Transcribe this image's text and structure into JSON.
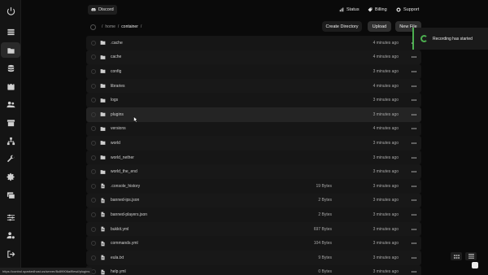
{
  "topbar": {
    "discord_label": "Discord",
    "status_label": "Status",
    "billing_label": "Billing",
    "support_label": "Support"
  },
  "breadcrumb": {
    "separator": "/",
    "home": "home",
    "container": "container"
  },
  "actions": {
    "create_directory": "Create Directory",
    "upload": "Upload",
    "new_file": "New File"
  },
  "toast": {
    "message": "Recording has started"
  },
  "status_url": "https://control.sparkedhost.us/server/8c89906a/files#/plugins",
  "sidebar": {
    "items": [
      "dashboard-icon",
      "files-icon",
      "database-icon",
      "schedule-icon",
      "users-icon",
      "backups-icon",
      "network-icon",
      "wrench-icon",
      "settings-icon",
      "console-icon",
      "sliders-icon",
      "user-settings-icon",
      "logout-icon"
    ]
  },
  "files": [
    {
      "name": ".cache",
      "type": "folder",
      "size": "",
      "date": "4 minutes ago"
    },
    {
      "name": "cache",
      "type": "folder",
      "size": "",
      "date": "4 minutes ago"
    },
    {
      "name": "config",
      "type": "folder",
      "size": "",
      "date": "3 minutes ago"
    },
    {
      "name": "libraries",
      "type": "folder",
      "size": "",
      "date": "4 minutes ago"
    },
    {
      "name": "logs",
      "type": "folder",
      "size": "",
      "date": "3 minutes ago"
    },
    {
      "name": "plugins",
      "type": "folder",
      "size": "",
      "date": "3 minutes ago"
    },
    {
      "name": "versions",
      "type": "folder",
      "size": "",
      "date": "4 minutes ago"
    },
    {
      "name": "world",
      "type": "folder",
      "size": "",
      "date": "3 minutes ago"
    },
    {
      "name": "world_nether",
      "type": "folder",
      "size": "",
      "date": "3 minutes ago"
    },
    {
      "name": "world_the_end",
      "type": "folder",
      "size": "",
      "date": "3 minutes ago"
    },
    {
      "name": ".console_history",
      "type": "file",
      "size": "19 Bytes",
      "date": "3 minutes ago"
    },
    {
      "name": "banned-ips.json",
      "type": "file",
      "size": "2 Bytes",
      "date": "3 minutes ago"
    },
    {
      "name": "banned-players.json",
      "type": "file",
      "size": "2 Bytes",
      "date": "3 minutes ago"
    },
    {
      "name": "bukkit.yml",
      "type": "file",
      "size": "697 Bytes",
      "date": "3 minutes ago"
    },
    {
      "name": "commands.yml",
      "type": "file",
      "size": "104 Bytes",
      "date": "3 minutes ago"
    },
    {
      "name": "eula.txt",
      "type": "file",
      "size": "9 Bytes",
      "date": "3 minutes ago"
    },
    {
      "name": "help.yml",
      "type": "file",
      "size": "0 Bytes",
      "date": "3 minutes ago"
    }
  ],
  "colors": {
    "accent_green": "#4caf50",
    "background": "#0a0a0a",
    "row": "#181818"
  }
}
